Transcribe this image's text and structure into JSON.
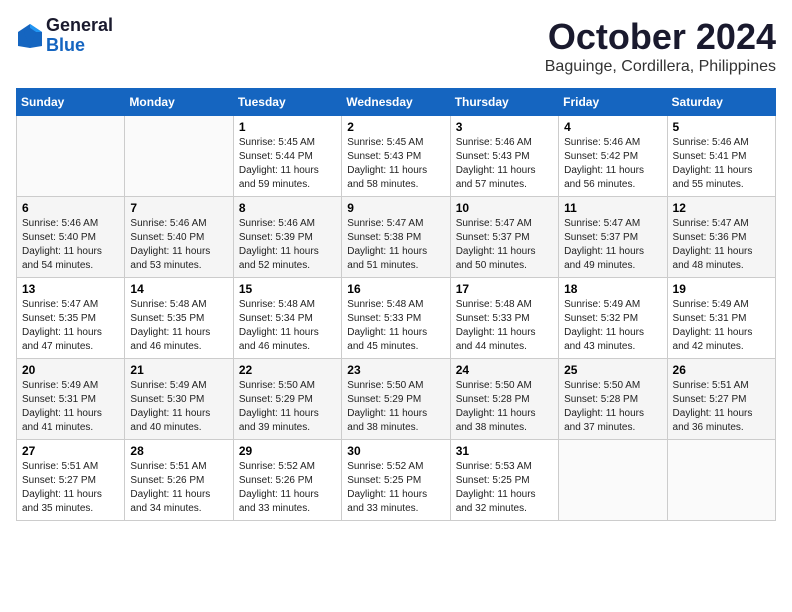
{
  "header": {
    "logo_line1": "General",
    "logo_line2": "Blue",
    "month": "October 2024",
    "location": "Baguinge, Cordillera, Philippines"
  },
  "days_of_week": [
    "Sunday",
    "Monday",
    "Tuesday",
    "Wednesday",
    "Thursday",
    "Friday",
    "Saturday"
  ],
  "weeks": [
    [
      {
        "day": "",
        "sunrise": "",
        "sunset": "",
        "daylight": ""
      },
      {
        "day": "",
        "sunrise": "",
        "sunset": "",
        "daylight": ""
      },
      {
        "day": "1",
        "sunrise": "Sunrise: 5:45 AM",
        "sunset": "Sunset: 5:44 PM",
        "daylight": "Daylight: 11 hours and 59 minutes."
      },
      {
        "day": "2",
        "sunrise": "Sunrise: 5:45 AM",
        "sunset": "Sunset: 5:43 PM",
        "daylight": "Daylight: 11 hours and 58 minutes."
      },
      {
        "day": "3",
        "sunrise": "Sunrise: 5:46 AM",
        "sunset": "Sunset: 5:43 PM",
        "daylight": "Daylight: 11 hours and 57 minutes."
      },
      {
        "day": "4",
        "sunrise": "Sunrise: 5:46 AM",
        "sunset": "Sunset: 5:42 PM",
        "daylight": "Daylight: 11 hours and 56 minutes."
      },
      {
        "day": "5",
        "sunrise": "Sunrise: 5:46 AM",
        "sunset": "Sunset: 5:41 PM",
        "daylight": "Daylight: 11 hours and 55 minutes."
      }
    ],
    [
      {
        "day": "6",
        "sunrise": "Sunrise: 5:46 AM",
        "sunset": "Sunset: 5:40 PM",
        "daylight": "Daylight: 11 hours and 54 minutes."
      },
      {
        "day": "7",
        "sunrise": "Sunrise: 5:46 AM",
        "sunset": "Sunset: 5:40 PM",
        "daylight": "Daylight: 11 hours and 53 minutes."
      },
      {
        "day": "8",
        "sunrise": "Sunrise: 5:46 AM",
        "sunset": "Sunset: 5:39 PM",
        "daylight": "Daylight: 11 hours and 52 minutes."
      },
      {
        "day": "9",
        "sunrise": "Sunrise: 5:47 AM",
        "sunset": "Sunset: 5:38 PM",
        "daylight": "Daylight: 11 hours and 51 minutes."
      },
      {
        "day": "10",
        "sunrise": "Sunrise: 5:47 AM",
        "sunset": "Sunset: 5:37 PM",
        "daylight": "Daylight: 11 hours and 50 minutes."
      },
      {
        "day": "11",
        "sunrise": "Sunrise: 5:47 AM",
        "sunset": "Sunset: 5:37 PM",
        "daylight": "Daylight: 11 hours and 49 minutes."
      },
      {
        "day": "12",
        "sunrise": "Sunrise: 5:47 AM",
        "sunset": "Sunset: 5:36 PM",
        "daylight": "Daylight: 11 hours and 48 minutes."
      }
    ],
    [
      {
        "day": "13",
        "sunrise": "Sunrise: 5:47 AM",
        "sunset": "Sunset: 5:35 PM",
        "daylight": "Daylight: 11 hours and 47 minutes."
      },
      {
        "day": "14",
        "sunrise": "Sunrise: 5:48 AM",
        "sunset": "Sunset: 5:35 PM",
        "daylight": "Daylight: 11 hours and 46 minutes."
      },
      {
        "day": "15",
        "sunrise": "Sunrise: 5:48 AM",
        "sunset": "Sunset: 5:34 PM",
        "daylight": "Daylight: 11 hours and 46 minutes."
      },
      {
        "day": "16",
        "sunrise": "Sunrise: 5:48 AM",
        "sunset": "Sunset: 5:33 PM",
        "daylight": "Daylight: 11 hours and 45 minutes."
      },
      {
        "day": "17",
        "sunrise": "Sunrise: 5:48 AM",
        "sunset": "Sunset: 5:33 PM",
        "daylight": "Daylight: 11 hours and 44 minutes."
      },
      {
        "day": "18",
        "sunrise": "Sunrise: 5:49 AM",
        "sunset": "Sunset: 5:32 PM",
        "daylight": "Daylight: 11 hours and 43 minutes."
      },
      {
        "day": "19",
        "sunrise": "Sunrise: 5:49 AM",
        "sunset": "Sunset: 5:31 PM",
        "daylight": "Daylight: 11 hours and 42 minutes."
      }
    ],
    [
      {
        "day": "20",
        "sunrise": "Sunrise: 5:49 AM",
        "sunset": "Sunset: 5:31 PM",
        "daylight": "Daylight: 11 hours and 41 minutes."
      },
      {
        "day": "21",
        "sunrise": "Sunrise: 5:49 AM",
        "sunset": "Sunset: 5:30 PM",
        "daylight": "Daylight: 11 hours and 40 minutes."
      },
      {
        "day": "22",
        "sunrise": "Sunrise: 5:50 AM",
        "sunset": "Sunset: 5:29 PM",
        "daylight": "Daylight: 11 hours and 39 minutes."
      },
      {
        "day": "23",
        "sunrise": "Sunrise: 5:50 AM",
        "sunset": "Sunset: 5:29 PM",
        "daylight": "Daylight: 11 hours and 38 minutes."
      },
      {
        "day": "24",
        "sunrise": "Sunrise: 5:50 AM",
        "sunset": "Sunset: 5:28 PM",
        "daylight": "Daylight: 11 hours and 38 minutes."
      },
      {
        "day": "25",
        "sunrise": "Sunrise: 5:50 AM",
        "sunset": "Sunset: 5:28 PM",
        "daylight": "Daylight: 11 hours and 37 minutes."
      },
      {
        "day": "26",
        "sunrise": "Sunrise: 5:51 AM",
        "sunset": "Sunset: 5:27 PM",
        "daylight": "Daylight: 11 hours and 36 minutes."
      }
    ],
    [
      {
        "day": "27",
        "sunrise": "Sunrise: 5:51 AM",
        "sunset": "Sunset: 5:27 PM",
        "daylight": "Daylight: 11 hours and 35 minutes."
      },
      {
        "day": "28",
        "sunrise": "Sunrise: 5:51 AM",
        "sunset": "Sunset: 5:26 PM",
        "daylight": "Daylight: 11 hours and 34 minutes."
      },
      {
        "day": "29",
        "sunrise": "Sunrise: 5:52 AM",
        "sunset": "Sunset: 5:26 PM",
        "daylight": "Daylight: 11 hours and 33 minutes."
      },
      {
        "day": "30",
        "sunrise": "Sunrise: 5:52 AM",
        "sunset": "Sunset: 5:25 PM",
        "daylight": "Daylight: 11 hours and 33 minutes."
      },
      {
        "day": "31",
        "sunrise": "Sunrise: 5:53 AM",
        "sunset": "Sunset: 5:25 PM",
        "daylight": "Daylight: 11 hours and 32 minutes."
      },
      {
        "day": "",
        "sunrise": "",
        "sunset": "",
        "daylight": ""
      },
      {
        "day": "",
        "sunrise": "",
        "sunset": "",
        "daylight": ""
      }
    ]
  ]
}
